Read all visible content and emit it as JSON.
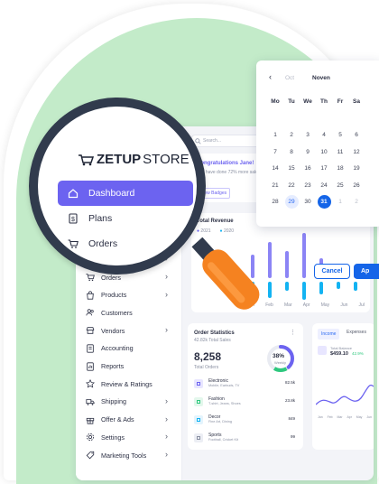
{
  "brand": {
    "name_bold": "ZETUP",
    "name_light": "STORE"
  },
  "search": {
    "placeholder": "Search..."
  },
  "lens_menu": [
    {
      "label": "Dashboard",
      "icon": "home-icon",
      "active": true
    },
    {
      "label": "Plans",
      "icon": "dollar-icon",
      "active": false
    },
    {
      "label": "Orders",
      "icon": "cart-icon",
      "active": false
    }
  ],
  "sidebar": {
    "items": [
      {
        "label": "Orders",
        "icon": "cart-icon",
        "chevron": true
      },
      {
        "label": "Products",
        "icon": "bag-icon",
        "chevron": true
      },
      {
        "label": "Customers",
        "icon": "users-icon",
        "chevron": false
      },
      {
        "label": "Vendors",
        "icon": "store-icon",
        "chevron": true
      },
      {
        "label": "Accounting",
        "icon": "ledger-icon",
        "chevron": false
      },
      {
        "label": "Reports",
        "icon": "report-icon",
        "chevron": false
      },
      {
        "label": "Review & Ratings",
        "icon": "star-icon",
        "chevron": false
      },
      {
        "label": "Shipping",
        "icon": "truck-icon",
        "chevron": true
      },
      {
        "label": "Offer & Ads",
        "icon": "gift-icon",
        "chevron": true
      },
      {
        "label": "Settings",
        "icon": "gear-icon",
        "chevron": true
      },
      {
        "label": "Marketing Tools",
        "icon": "tag-icon",
        "chevron": true
      }
    ]
  },
  "congrats": {
    "title": "Congratulations Jane!",
    "text": "You have done 72% more sales in",
    "button": "View Badges"
  },
  "revenue": {
    "title": "Total Revenue",
    "legend": [
      "2021",
      "2020"
    ],
    "months": [
      "Jan",
      "Feb",
      "Mar",
      "Apr",
      "May",
      "Jun",
      "Jul"
    ]
  },
  "order_stats": {
    "title": "Order Statistics",
    "subtitle": "42.82k Total Sales",
    "total": "8,258",
    "total_label": "Total Orders",
    "ring_value": "38%",
    "ring_label": "Weekly",
    "ring_fraction": 0.38,
    "rows": [
      {
        "name": "Electronic",
        "desc": "Mobile, Earbuds, TV",
        "value": "82.5k"
      },
      {
        "name": "Fashion",
        "desc": "T-shirt, Jeans, Shoes",
        "value": "23.8k"
      },
      {
        "name": "Decor",
        "desc": "Fine Art, Dining",
        "value": "849"
      },
      {
        "name": "Sports",
        "desc": "Football, Cricket Kit",
        "value": "99"
      }
    ]
  },
  "income": {
    "tabs": [
      "Income",
      "Expenses"
    ],
    "label": "Total Balance",
    "value": "$459.10",
    "change": "42.9%",
    "axis": [
      "Jan",
      "Feb",
      "Mar",
      "Apr",
      "May",
      "Jun"
    ]
  },
  "calendar": {
    "months": [
      "Oct",
      "Noven"
    ],
    "weekdays": [
      "Mo",
      "Tu",
      "We",
      "Th",
      "Fr",
      "Sa"
    ],
    "rows": [
      [
        "",
        "",
        "",
        "",
        "",
        ""
      ],
      [
        "1",
        "2",
        "3",
        "4",
        "5",
        "6"
      ],
      [
        "7",
        "8",
        "9",
        "10",
        "11",
        "12"
      ],
      [
        "14",
        "15",
        "16",
        "17",
        "18",
        "19"
      ],
      [
        "21",
        "22",
        "23",
        "24",
        "25",
        "26"
      ],
      [
        "28",
        "29",
        "30",
        "31",
        "1",
        "2"
      ]
    ],
    "cancel": "Cancel",
    "apply": "Ap"
  },
  "colors": {
    "accent": "#6c63f0",
    "blue": "#1565e8",
    "green_bg": "#c3ebc9",
    "lens": "#313b4d",
    "handle": "#f58220"
  }
}
